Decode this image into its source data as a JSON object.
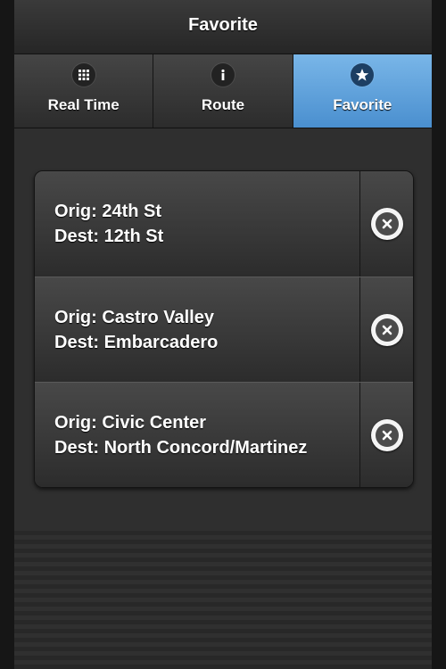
{
  "header": {
    "title": "Favorite"
  },
  "tabs": [
    {
      "label": "Real Time",
      "icon": "grid-icon",
      "active": false
    },
    {
      "label": "Route",
      "icon": "info-icon",
      "active": false
    },
    {
      "label": "Favorite",
      "icon": "star-icon",
      "active": true
    }
  ],
  "favorites": [
    {
      "orig": "Orig: 24th St",
      "dest": "Dest: 12th St"
    },
    {
      "orig": "Orig: Castro Valley",
      "dest": "Dest: Embarcadero"
    },
    {
      "orig": "Orig: Civic Center",
      "dest": "Dest: North Concord/Martinez"
    }
  ],
  "colors": {
    "active_tab": "#5a9fdc",
    "background": "#2f2f2f"
  }
}
